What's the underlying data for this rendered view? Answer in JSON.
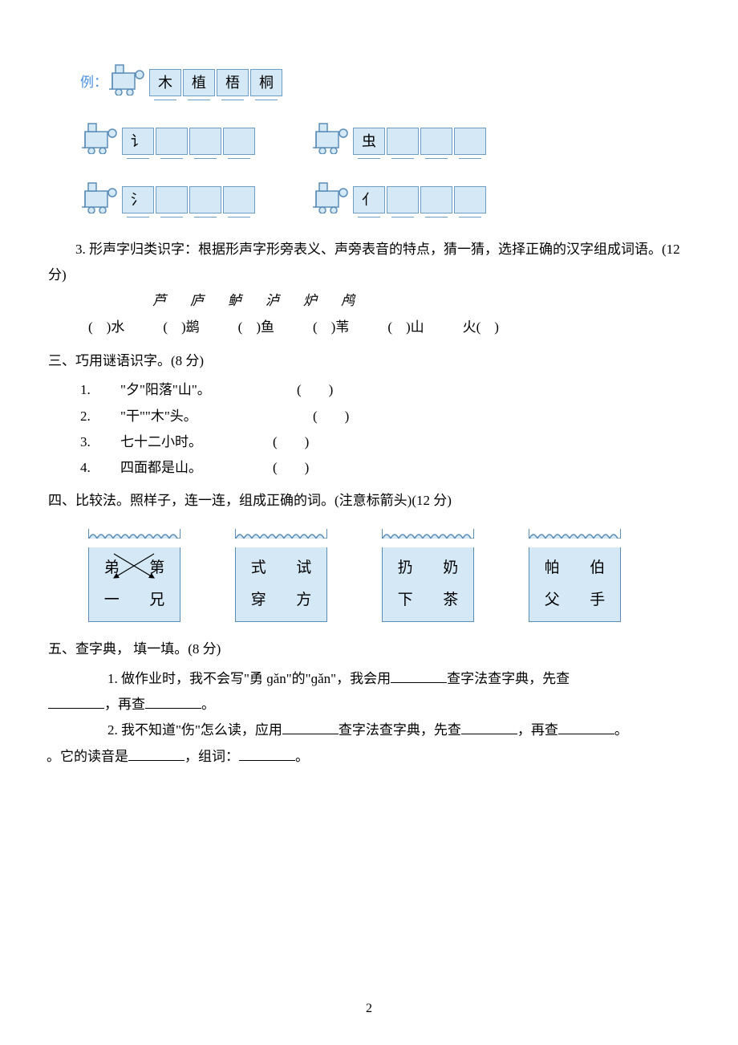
{
  "example": {
    "label": "例：",
    "cars": [
      "木",
      "植",
      "梧",
      "桐"
    ]
  },
  "trains": {
    "row1_left": "讠",
    "row1_right": "虫",
    "row2_left": "氵",
    "row2_right": "亻"
  },
  "q3": {
    "text": "3. 形声字归类识字：根据形声字形旁表义、声旁表音的特点，猜一猜，选择正确的汉字组成词语。(12 分)",
    "options": "芦庐鲈泸炉鸬",
    "fills": [
      "(　)水",
      "(　)鹚",
      "(　)鱼",
      "(　)苇",
      "(　)山",
      "火(　)"
    ]
  },
  "s3": {
    "head": "三、巧用谜语识字。(8 分)",
    "rows": [
      {
        "n": "1.",
        "t": "\"夕\"阳落\"山\"。",
        "p": "(　　)"
      },
      {
        "n": "2.",
        "t": "\"干\"\"木\"头。",
        "p": "(　　)"
      },
      {
        "n": "3.",
        "t": "七十二小时。",
        "p": "(　　)"
      },
      {
        "n": "4.",
        "t": "四面都是山。",
        "p": "(　　)"
      }
    ]
  },
  "s4": {
    "head": "四、比较法。照样子，连一连，组成正确的词。(注意标箭头)(12 分)",
    "boxes": [
      {
        "top": [
          "弟",
          "第"
        ],
        "bottom": [
          "一",
          "兄"
        ],
        "arrows": true
      },
      {
        "top": [
          "式",
          "试"
        ],
        "bottom": [
          "穿",
          "方"
        ],
        "arrows": false
      },
      {
        "top": [
          "扔",
          "奶"
        ],
        "bottom": [
          "下",
          "茶"
        ],
        "arrows": false
      },
      {
        "top": [
          "帕",
          "伯"
        ],
        "bottom": [
          "父",
          "手"
        ],
        "arrows": false
      }
    ]
  },
  "s5": {
    "head": "五、查字典， 填一填。(8 分)",
    "q1a": "1. 做作业时，我不会写\"勇 ɡǎn\"的\"ɡǎn\"，我会用",
    "q1b": "查字法查字典，先查",
    "q1c": "，再查",
    "q1d": "。",
    "q2a": "2. 我不知道\"伤\"怎么读，应用",
    "q2b": "查字法查字典，先查",
    "q2c": "，再查",
    "q2d": "。它的读音是",
    "q2e": "，组词：",
    "q2f": "。"
  },
  "pagenum": "2"
}
